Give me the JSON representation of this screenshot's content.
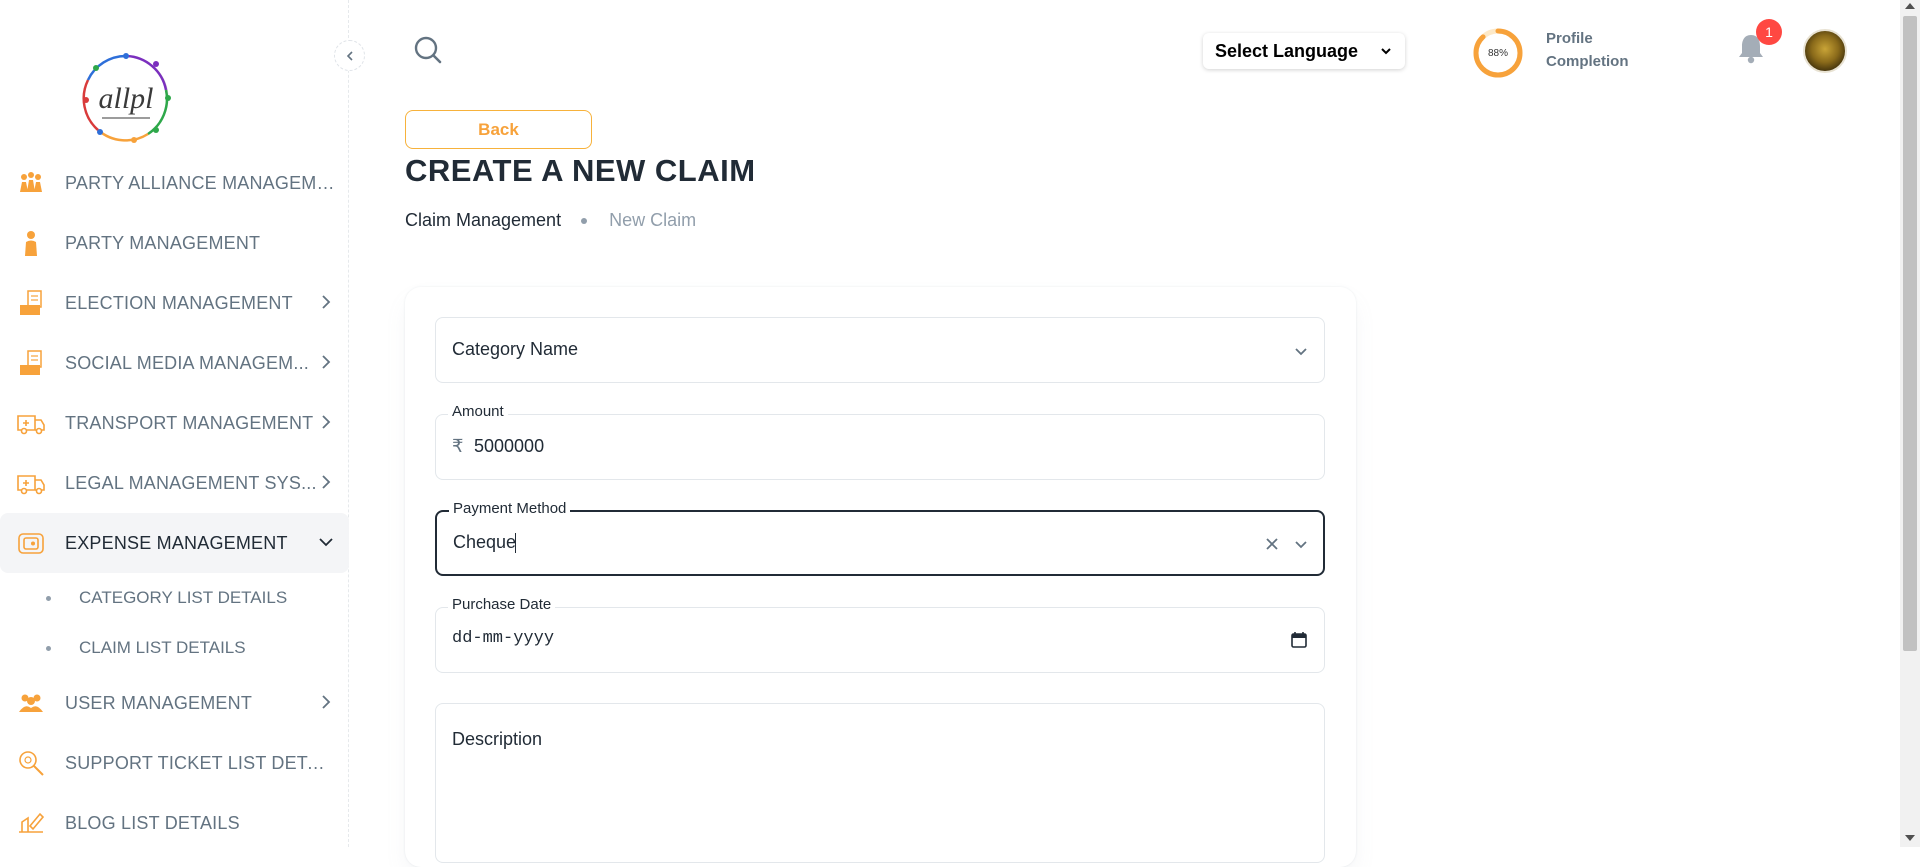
{
  "sidebar": {
    "logo_text": "allpl",
    "items": [
      {
        "label": "PARTY ALLIANCE MANAGEME..."
      },
      {
        "label": "PARTY MANAGEMENT"
      },
      {
        "label": "ELECTION MANAGEMENT"
      },
      {
        "label": "SOCIAL MEDIA MANAGEM..."
      },
      {
        "label": "TRANSPORT MANAGEMENT"
      },
      {
        "label": "LEGAL MANAGEMENT SYS..."
      },
      {
        "label": "EXPENSE MANAGEMENT"
      },
      {
        "label": "USER MANAGEMENT"
      },
      {
        "label": "SUPPORT TICKET LIST DETAILS"
      },
      {
        "label": "BLOG LIST DETAILS"
      }
    ],
    "sub_items": [
      {
        "label": "CATEGORY LIST DETAILS"
      },
      {
        "label": "CLAIM LIST DETAILS"
      }
    ]
  },
  "header": {
    "language_select": "Select Language",
    "profile_progress": "88%",
    "profile_progress_value": 0.88,
    "profile_label": "Profile Completion",
    "notification_count": "1"
  },
  "main": {
    "back_label": "Back",
    "title": "CREATE A NEW CLAIM",
    "breadcrumb": [
      "Claim Management",
      "New Claim"
    ],
    "form": {
      "category_placeholder": "Category Name",
      "amount_label": "Amount",
      "currency_symbol": "₹",
      "amount_value": "5000000",
      "payment_label": "Payment Method",
      "payment_value": "Cheque",
      "purchase_label": "Purchase Date",
      "purchase_placeholder": "dd-mm-yyyy",
      "description_placeholder": "Description"
    }
  },
  "colors": {
    "accent": "#f7a23b",
    "badge": "#ff4842",
    "text_primary": "#212b36",
    "text_secondary": "#637381"
  },
  "icons": [
    "search-icon",
    "chevron-left-icon",
    "chevron-right-icon",
    "chevron-down-icon",
    "bell-icon",
    "calendar-icon",
    "clear-icon"
  ]
}
